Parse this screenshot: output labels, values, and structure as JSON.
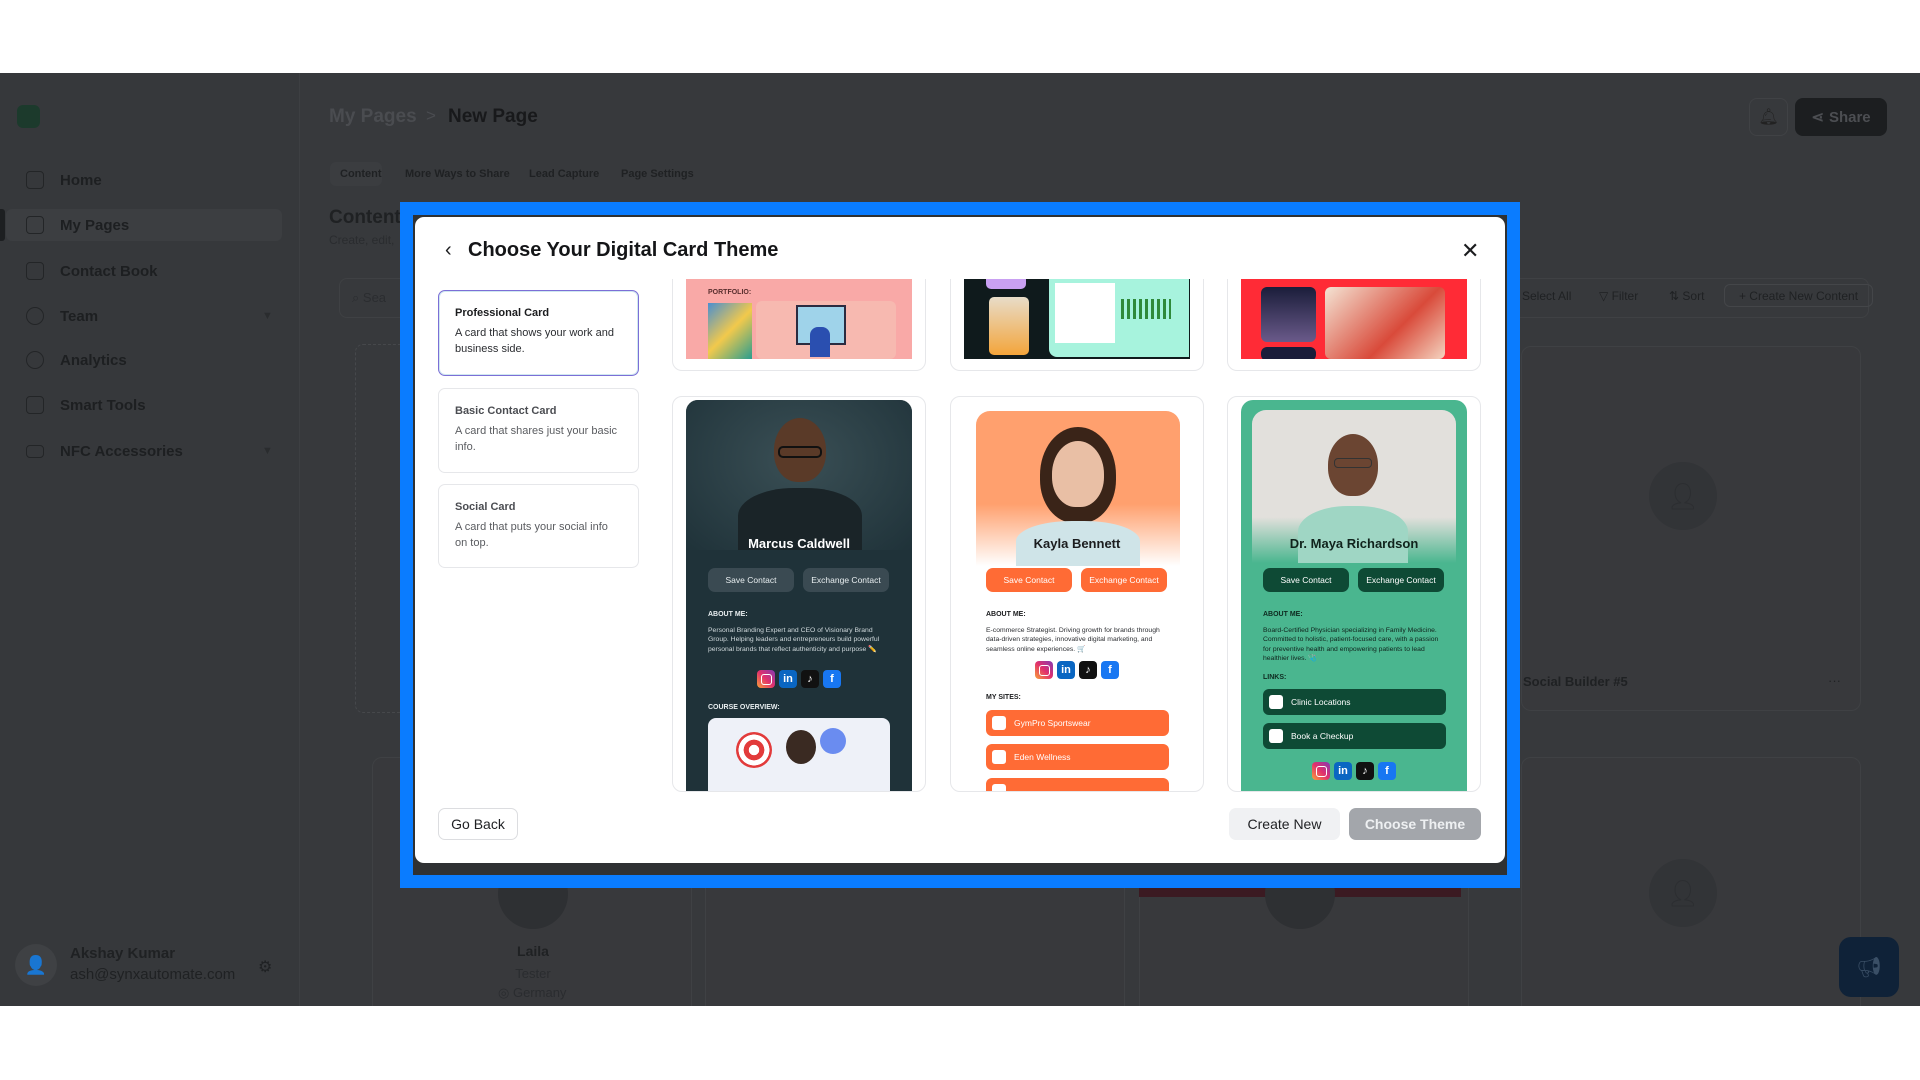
{
  "sidebar": {
    "items": [
      {
        "label": "Home",
        "icon": "home-icon"
      },
      {
        "label": "My Pages",
        "icon": "pages-icon",
        "active": true
      },
      {
        "label": "Contact Book",
        "icon": "contact-book-icon"
      },
      {
        "label": "Team",
        "icon": "team-icon",
        "has_chevron": true
      },
      {
        "label": "Analytics",
        "icon": "analytics-icon"
      },
      {
        "label": "Smart Tools",
        "icon": "grid-icon"
      },
      {
        "label": "NFC Accessories",
        "icon": "card-icon",
        "has_chevron": true
      }
    ],
    "user": {
      "name": "Akshay Kumar",
      "email": "ash@synxautomate.com"
    }
  },
  "header": {
    "breadcrumb_parent": "My Pages",
    "breadcrumb_sep": ">",
    "breadcrumb_current": "New Page",
    "share_label": "Share"
  },
  "tabs": [
    "Content",
    "More Ways to Share",
    "Lead Capture",
    "Page Settings"
  ],
  "content": {
    "title": "Content Library",
    "subtitle": "Create, edit,",
    "search_placeholder": "Sea",
    "toolbar": {
      "select_all": "Select All",
      "filter": "Filter",
      "sort": "Sort",
      "create": "+ Create New Content"
    },
    "cards": [
      {
        "title": "Social Builder #5",
        "more": "···"
      },
      {
        "name": "Laila",
        "role": "Tester",
        "location": "Germany"
      }
    ]
  },
  "modal": {
    "title": "Choose Your Digital Card Theme",
    "options": [
      {
        "title": "Professional Card",
        "desc": "A card that shows your work and business side.",
        "selected": true
      },
      {
        "title": "Basic Contact Card",
        "desc": "A card that shares just your basic info."
      },
      {
        "title": "Social Card",
        "desc": "A card that puts your social info on top."
      }
    ],
    "top_row": {
      "portfolio_label": "PORTFOLIO:"
    },
    "themes": [
      {
        "name": "Marcus Caldwell",
        "save": "Save Contact",
        "exchange": "Exchange Contact",
        "about_label": "ABOUT ME:",
        "about": "Personal Branding Expert and CEO of Visionary Brand Group. Helping leaders and entrepreneurs build powerful personal brands that reflect authenticity and purpose ✏️",
        "section_label": "COURSE OVERVIEW:",
        "colors": {
          "bg": "#1f3239",
          "button": "#3a4a52"
        }
      },
      {
        "name": "Kayla Bennett",
        "save": "Save Contact",
        "exchange": "Exchange Contact",
        "about_label": "ABOUT ME:",
        "about": "E-commerce Strategist. Driving growth for brands through data-driven strategies, innovative digital marketing, and seamless online experiences. 🛒",
        "section_label": "MY SITES:",
        "sites": [
          "GymPro Sportswear",
          "Eden Wellness"
        ],
        "colors": {
          "accent": "#ff6b35"
        }
      },
      {
        "name": "Dr. Maya Richardson",
        "save": "Save Contact",
        "exchange": "Exchange Contact",
        "about_label": "ABOUT ME:",
        "about": "Board-Certified Physician specializing in Family Medicine. Committed to holistic, patient-focused care, with a passion for preventive health and empowering patients to lead healthier lives. 🩺",
        "section_label": "LINKS:",
        "links": [
          "Clinic Locations",
          "Book a Checkup"
        ],
        "colors": {
          "bg": "#4ab68f",
          "button": "#0e4a35"
        }
      }
    ],
    "social_icons": [
      "instagram-icon",
      "linkedin-icon",
      "tiktok-icon",
      "facebook-icon"
    ],
    "footer": {
      "go_back": "Go Back",
      "create_new": "Create New",
      "choose_theme": "Choose Theme"
    }
  },
  "colors": {
    "highlight": "#0a7cff",
    "overlay": "#37393c"
  }
}
